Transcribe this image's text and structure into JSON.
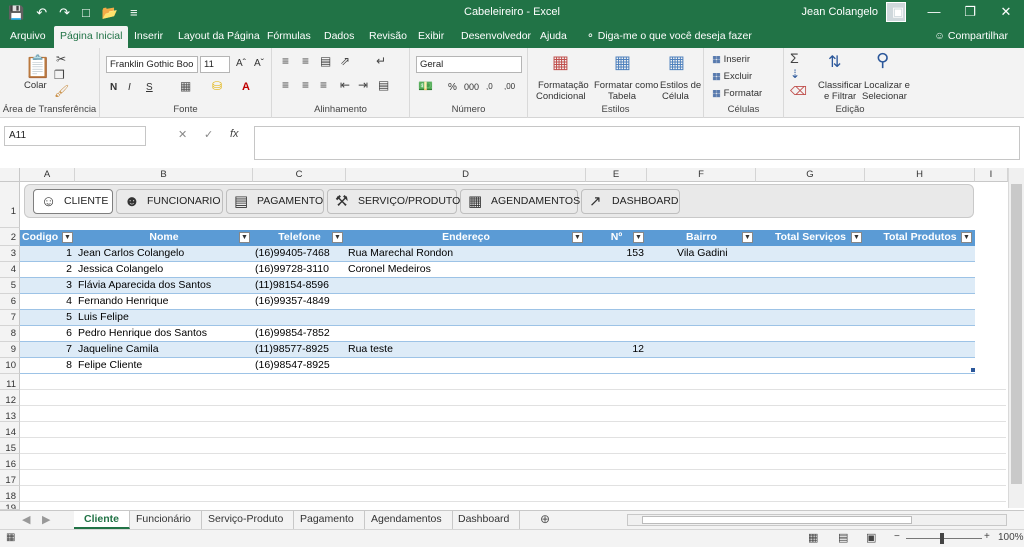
{
  "window": {
    "title": "Cabeleireiro - Excel",
    "user": "Jean Colangelo"
  },
  "ribbon_tabs": [
    "Arquivo",
    "Página Inicial",
    "Inserir",
    "Layout da Página",
    "Fórmulas",
    "Dados",
    "Revisão",
    "Exibir",
    "Desenvolvedor",
    "Ajuda"
  ],
  "tell_me": "Diga-me o que você deseja fazer",
  "share": "Compartilhar",
  "ribbon": {
    "paste": "Colar",
    "clipboard": "Área de Transferência",
    "font_name": "Franklin Gothic Boo",
    "font_size": "11",
    "font_group": "Fonte",
    "bold": "N",
    "italic": "I",
    "underline": "S",
    "alignment": "Alinhamento",
    "number_format": "Geral",
    "number": "Número",
    "conditional_1": "Formatação",
    "conditional_2": "Condicional",
    "format_table_1": "Formatar como",
    "format_table_2": "Tabela",
    "cell_styles_1": "Estilos de",
    "cell_styles_2": "Célula",
    "styles": "Estilos",
    "insert": "Inserir",
    "delete": "Excluir",
    "format": "Formatar",
    "cells": "Células",
    "sort_1": "Classificar",
    "sort_2": "e Filtrar",
    "find_1": "Localizar e",
    "find_2": "Selecionar",
    "editing": "Edição"
  },
  "formula_bar": {
    "name_box": "A11",
    "fx": "fx"
  },
  "columns": [
    "A",
    "B",
    "C",
    "D",
    "E",
    "F",
    "G",
    "H",
    "I"
  ],
  "rows": [
    "1",
    "2",
    "3",
    "4",
    "5",
    "6",
    "7",
    "8",
    "9",
    "10",
    "11",
    "12",
    "13",
    "14",
    "15",
    "16",
    "17",
    "18",
    "19"
  ],
  "nav_buttons": [
    "CLIENTE",
    "FUNCIONARIO",
    "PAGAMENTO",
    "SERVIÇO/PRODUTO",
    "AGENDAMENTOS",
    "DASHBOARD"
  ],
  "table": {
    "headers": [
      "Codigo",
      "Nome",
      "Telefone",
      "Endereço",
      "Nº",
      "Bairro",
      "Total Serviços",
      "Total Produtos"
    ],
    "rows": [
      [
        "1",
        "Jean Carlos Colangelo",
        "(16)99405-7468",
        "Rua Marechal Rondon",
        "153",
        "Vila Gadini"
      ],
      [
        "2",
        "Jessica Colangelo",
        "(16)99728-3110",
        "Coronel Medeiros",
        "",
        ""
      ],
      [
        "3",
        "Flávia Aparecida dos Santos",
        "(11)98154-8596",
        "",
        "",
        ""
      ],
      [
        "4",
        "Fernando Henrique",
        "(16)99357-4849",
        "",
        "",
        ""
      ],
      [
        "5",
        "Luis Felipe",
        "",
        "",
        "",
        ""
      ],
      [
        "6",
        "Pedro Henrique dos Santos",
        "(16)99854-7852",
        "",
        "",
        ""
      ],
      [
        "7",
        "Jaqueline Camila",
        "(11)98577-8925",
        "Rua teste",
        "12",
        ""
      ],
      [
        "8",
        "Felipe Cliente",
        "(16)98547-8925",
        "",
        "",
        ""
      ]
    ]
  },
  "sheet_tabs": [
    "Cliente",
    "Funcionário",
    "Serviço-Produto",
    "Pagamento",
    "Agendamentos",
    "Dashboard"
  ],
  "zoom": "100%",
  "colors": {
    "excel_green": "#217346",
    "table_header": "#5b9bd5",
    "band": "#ddebf7"
  }
}
